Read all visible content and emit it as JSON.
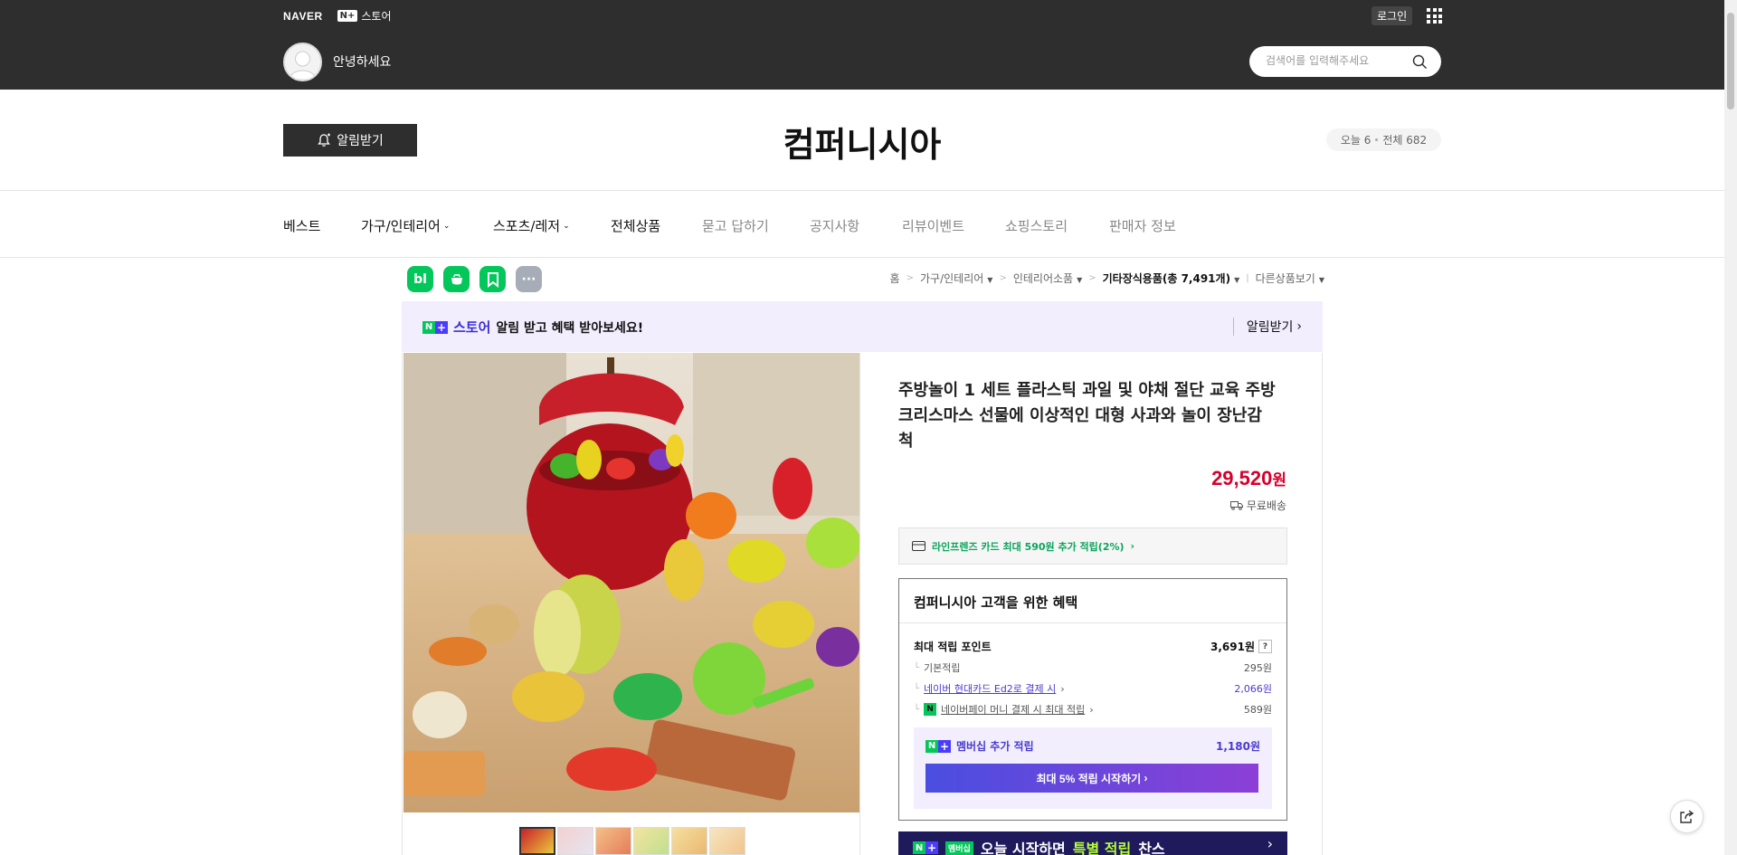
{
  "header": {
    "naver_logo": "NAVER",
    "store_logo_n": "N",
    "store_logo_label": "스토어",
    "login_label": "로그인",
    "greeting": "안녕하세요",
    "search_placeholder": "검색어를 입력해주세요"
  },
  "store": {
    "alarm_label": "알림받기",
    "title": "컴퍼니시아",
    "today_label": "오늘 6",
    "total_label": "전체 682"
  },
  "nav": {
    "items": [
      {
        "label": "베스트"
      },
      {
        "label": "가구/인테리어"
      },
      {
        "label": "스포츠/레저"
      },
      {
        "label": "전체상품"
      },
      {
        "label": "묻고 답하기"
      },
      {
        "label": "공지사항"
      },
      {
        "label": "리뷰이벤트"
      },
      {
        "label": "쇼핑스토리"
      },
      {
        "label": "판매자 정보"
      }
    ]
  },
  "quick_icons": {
    "blog": "bl",
    "more": "···"
  },
  "breadcrumb": {
    "home": "홈",
    "cat1": "가구/인테리어",
    "cat2": "인테리어소품",
    "cat3": "기타장식용품(총 7,491개)",
    "other": "다른상품보기"
  },
  "promo": {
    "store_word": "스토어",
    "text": "알림 받고 혜택 받아보세요!",
    "action": "알림받기"
  },
  "product": {
    "title": "주방놀이 1 세트 플라스틱 과일 및 야채 절단 교육 주방 크리스마스 선물에 이상적인 대형 사과와 놀이 장난감 척",
    "price": "29,520",
    "price_unit": "원",
    "shipping": "무료배송",
    "card_promo": "라인프렌즈 카드 최대 590원 추가 적립(2%)"
  },
  "benefit": {
    "title": "컴퍼니시아 고객을 위한 혜택",
    "max_points_label": "최대 적립 포인트",
    "max_points_value": "3,691원",
    "help": "?",
    "basic_label": "기본적립",
    "basic_value": "295원",
    "card_label": "네이버 현대카드 Ed2로 결제 시",
    "card_value": "2,066원",
    "pay_label": "네이버페이 머니 결제 시 최대 적립",
    "pay_value": "589원",
    "npay_mark": "N",
    "member_label": "멤버십 추가 적립",
    "member_value": "1,180원",
    "member_button": "최대 5% 적립 시작하기"
  },
  "bottom_banner": {
    "badge": "멤버십",
    "text_1": "오늘 시작하면",
    "highlight": "특별 적립",
    "text_2": "찬스"
  },
  "colors": {
    "header_bg": "#2e2e2e",
    "price_red": "#d7002b",
    "naver_green": "#03c75a",
    "membership_purple": "#4a3bd0",
    "promo_bg": "#f2eefe"
  }
}
